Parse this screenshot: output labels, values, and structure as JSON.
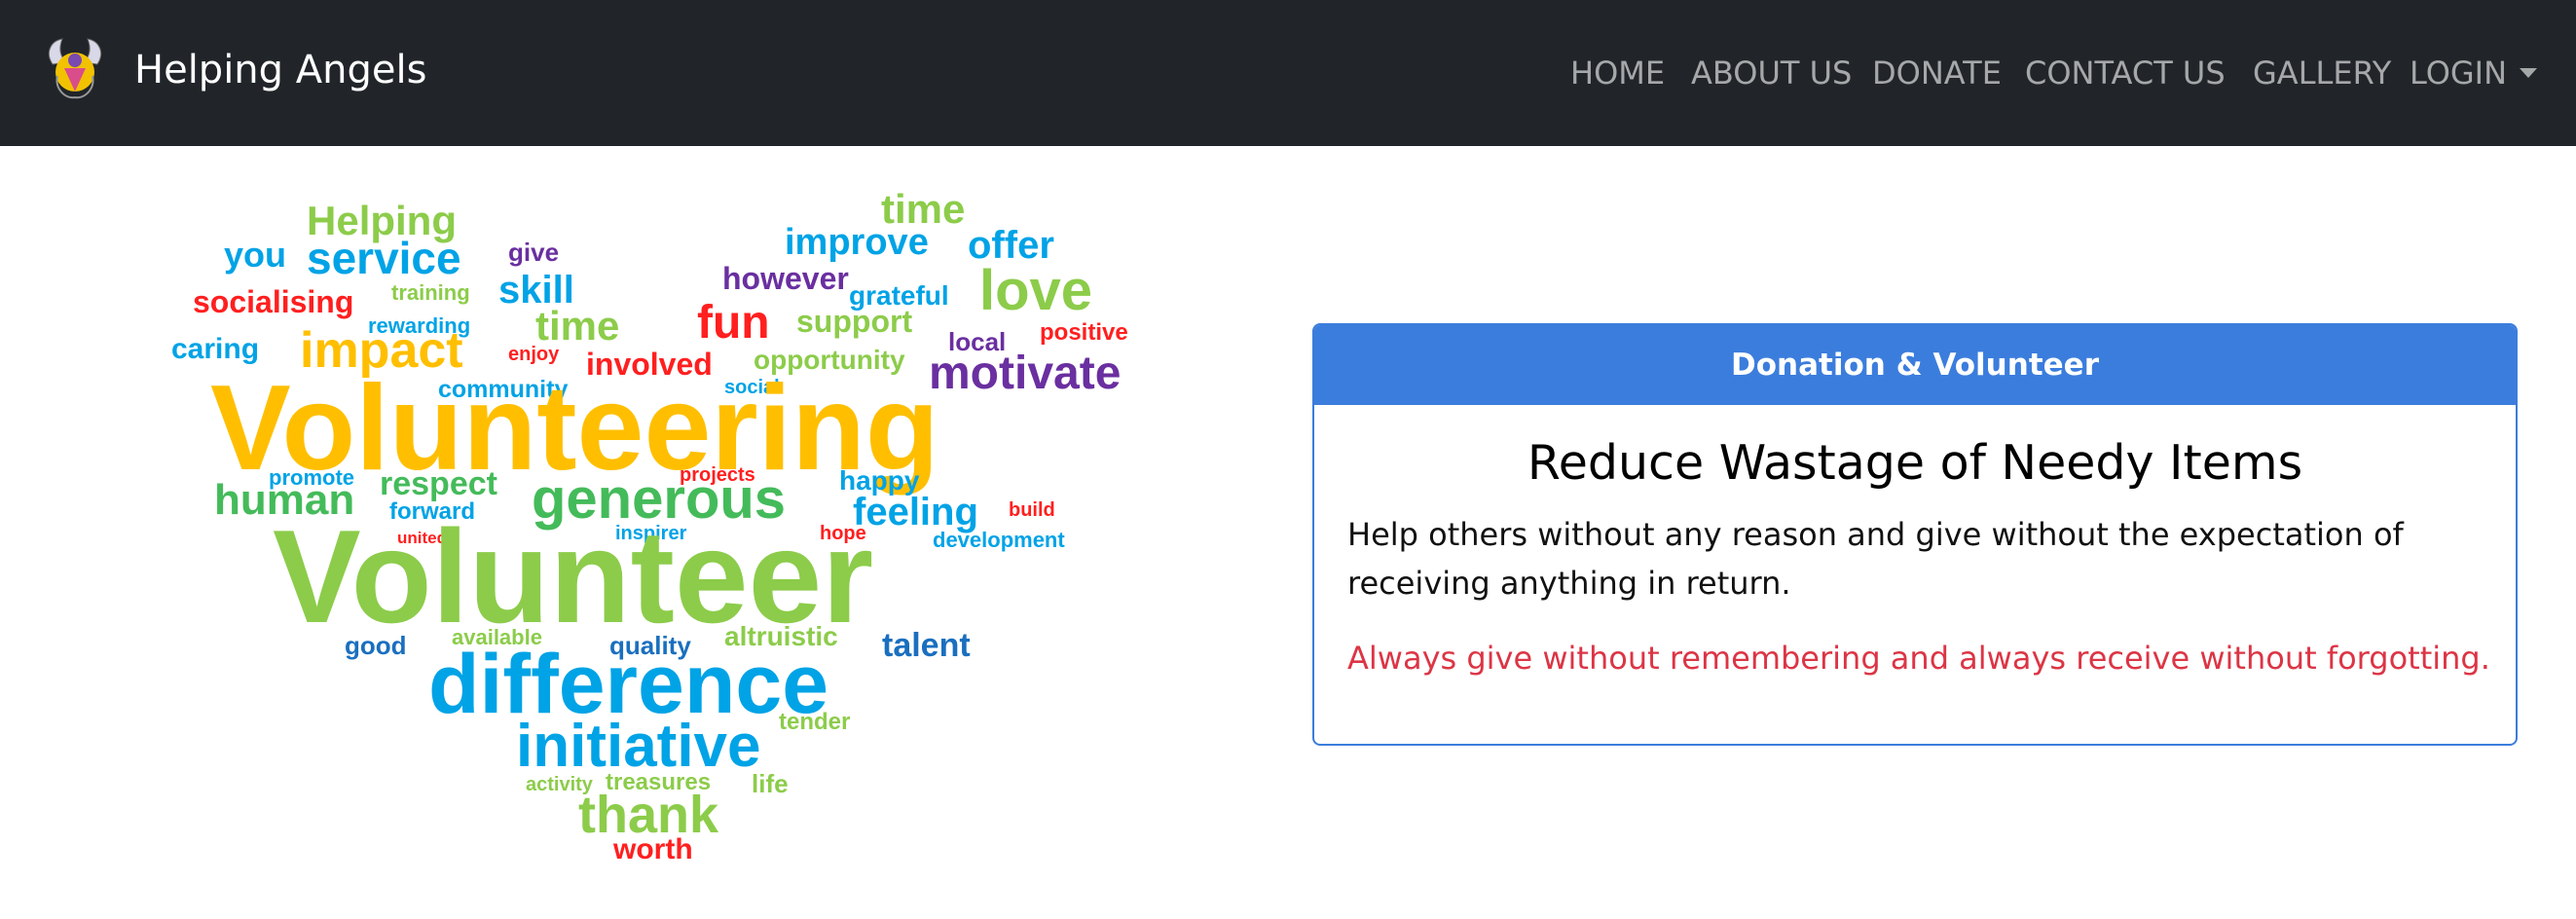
{
  "navbar": {
    "brand": "Helping Angels",
    "logo_icon": "angel-logo-icon",
    "items": [
      {
        "label": "HOME"
      },
      {
        "label": "ABOUT US"
      },
      {
        "label": "DONATE"
      },
      {
        "label": "CONTACT US"
      },
      {
        "label": "GALLERY"
      },
      {
        "label": "LOGIN"
      }
    ]
  },
  "colors": {
    "navbar_bg": "#212529",
    "accent": "#3b7ddd",
    "quote": "#dc3545",
    "cloud_yellow": "#ffbf00",
    "cloud_green": "#8ccc4a",
    "cloud_blue": "#00a3e6",
    "cloud_red": "#ff1f1f",
    "cloud_purple": "#6a2fa0",
    "cloud_navy": "#1a6fbf"
  },
  "word_cloud": {
    "words": [
      "Helping",
      "time",
      "you",
      "service",
      "give",
      "improve",
      "offer",
      "however",
      "socialising",
      "training",
      "skill",
      "grateful",
      "love",
      "fun",
      "support",
      "time",
      "rewarding",
      "caring",
      "impact",
      "enjoy",
      "involved",
      "local",
      "positive",
      "opportunity",
      "community",
      "social",
      "motivate",
      "Volunteering",
      "promote",
      "projects",
      "happy",
      "human",
      "respect",
      "generous",
      "forward",
      "feeling",
      "build",
      "united",
      "inspirer",
      "hope",
      "development",
      "Volunteer",
      "available",
      "altruistic",
      "good",
      "quality",
      "talent",
      "difference",
      "tender",
      "initiative",
      "activity",
      "treasures",
      "life",
      "thank",
      "worth"
    ]
  },
  "card": {
    "header": "Donation & Volunteer",
    "title": "Reduce Wastage of Needy Items",
    "text": "Help others without any reason and give without the expectation of receiving anything in return.",
    "quote": "Always give without remembering and always receive without forgotting."
  }
}
